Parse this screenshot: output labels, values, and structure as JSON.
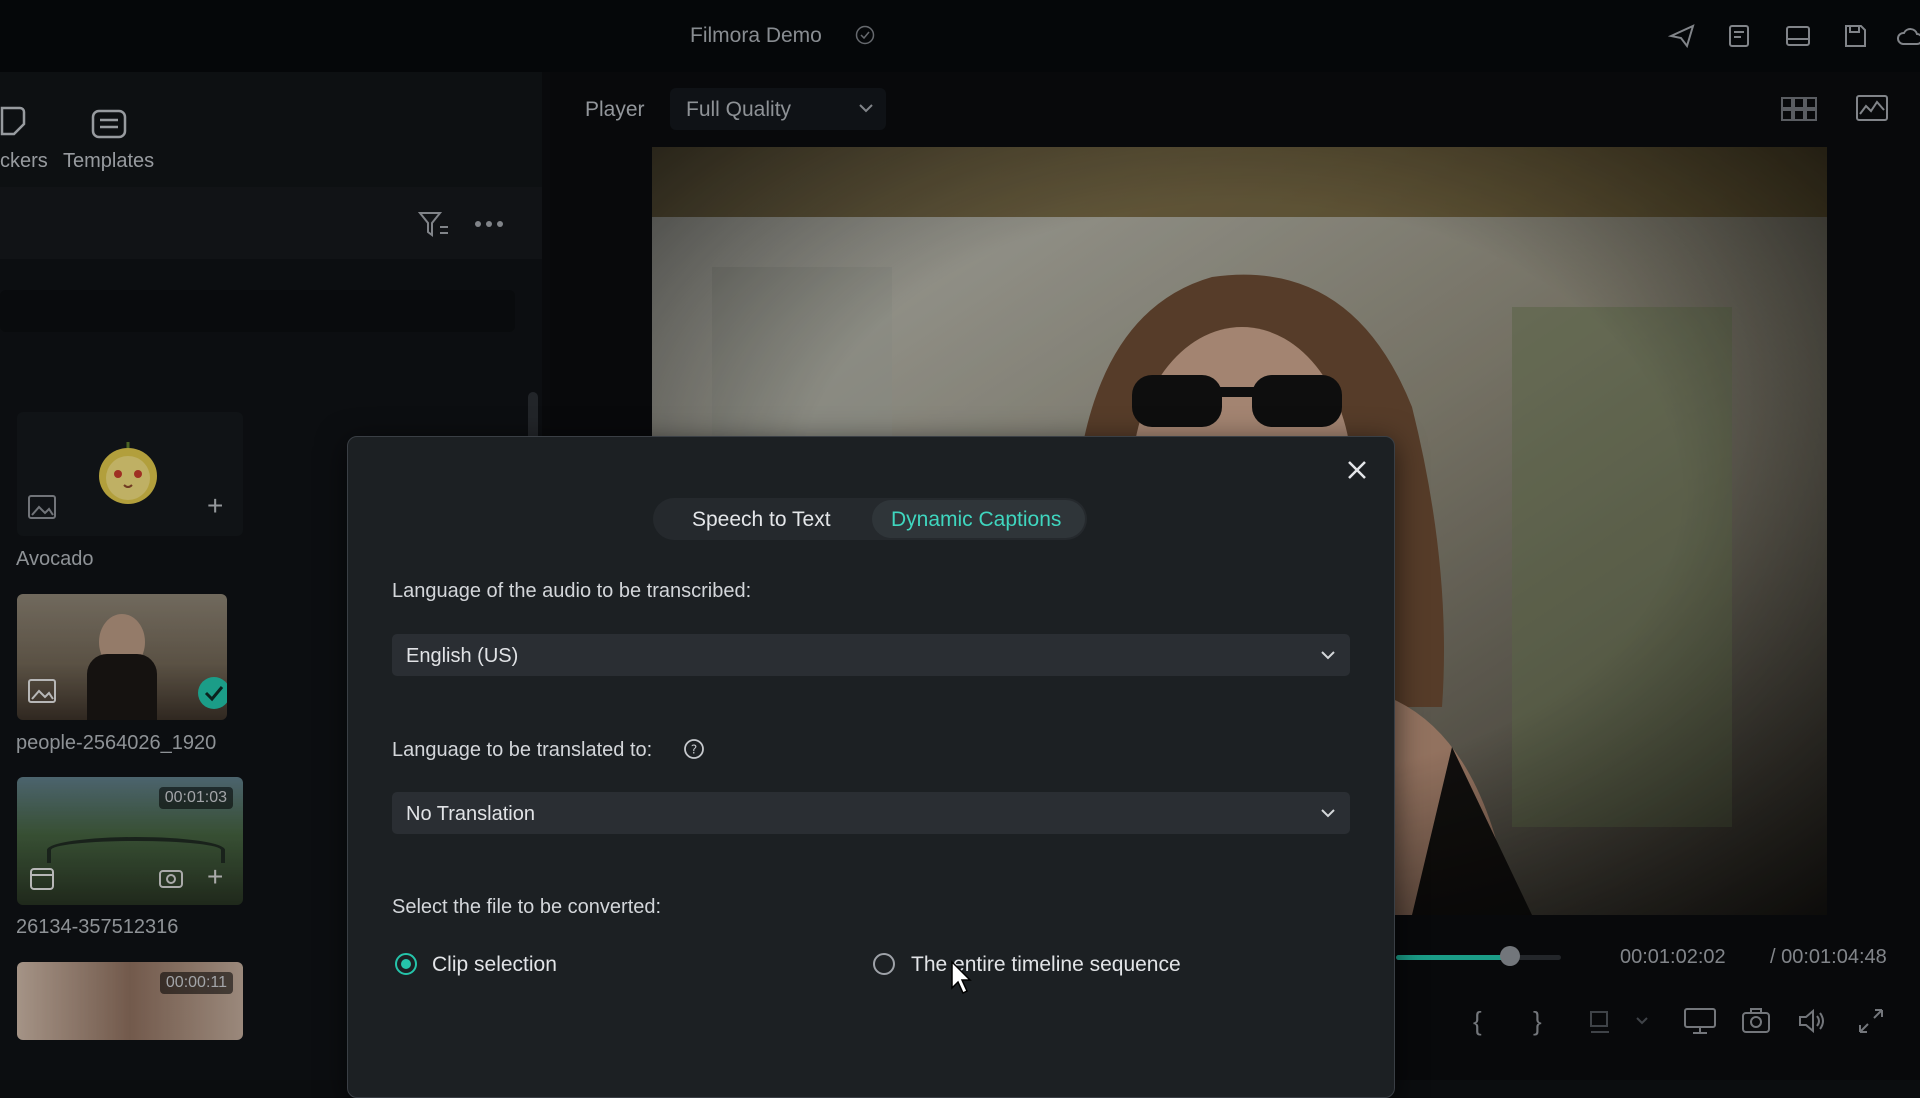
{
  "app": {
    "title": "Filmora Demo"
  },
  "left_panel": {
    "tabs": [
      {
        "label": "ckers",
        "icon": "stickers-icon"
      },
      {
        "label": "Templates",
        "icon": "templates-icon"
      }
    ],
    "assets": [
      {
        "name": "Avocado",
        "type": "sticker"
      },
      {
        "name": "people-2564026_1920",
        "type": "image",
        "checked": true
      },
      {
        "name": "26134-357512316",
        "type": "video",
        "duration": "00:01:03"
      },
      {
        "name": "",
        "type": "video",
        "duration": "00:00:11"
      }
    ]
  },
  "player": {
    "label": "Player",
    "quality": "Full Quality",
    "current_time": "00:01:02:02",
    "total_time": "/  00:01:04:48",
    "progress": 0.69
  },
  "dialog": {
    "tabs": [
      {
        "label": "Speech to Text",
        "active": false
      },
      {
        "label": "Dynamic Captions",
        "active": true
      }
    ],
    "audio_language_label": "Language of the audio to be transcribed:",
    "audio_language_value": "English (US)",
    "translate_label": "Language to be translated to:",
    "translate_value": "No Translation",
    "file_label": "Select the file to be converted:",
    "options": [
      {
        "label": "Clip selection",
        "selected": true
      },
      {
        "label": "The entire timeline sequence",
        "selected": false
      }
    ]
  },
  "colors": {
    "accent": "#21c0a6",
    "dialog_bg": "#1c2023",
    "active_tab_text": "#3fd6bf"
  }
}
